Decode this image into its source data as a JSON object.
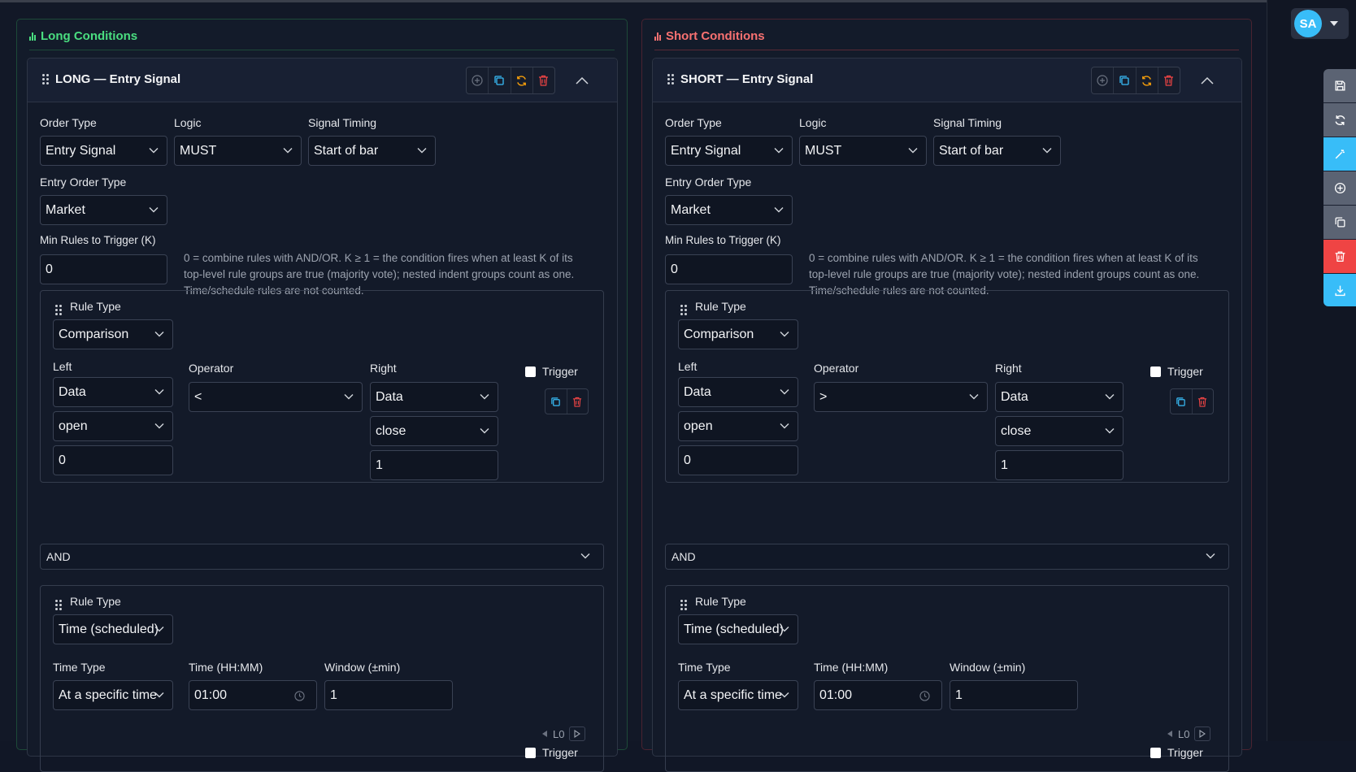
{
  "colors": {
    "long_accent": "#4ade80",
    "short_accent": "#f87171",
    "info": "#38bdf8",
    "warn": "#f59e0b",
    "danger": "#ef4444"
  },
  "user": {
    "initials": "SA"
  },
  "sidetools": [
    {
      "name": "save",
      "icon": "save-icon",
      "color": "#5b6373"
    },
    {
      "name": "refresh",
      "icon": "refresh-icon",
      "color": "#5b6373"
    },
    {
      "name": "magic",
      "icon": "magic-wand-icon",
      "color": "#38bdf8"
    },
    {
      "name": "add",
      "icon": "plus-circle-icon",
      "color": "#5b6373"
    },
    {
      "name": "copy",
      "icon": "copy-icon",
      "color": "#5b6373"
    },
    {
      "name": "delete",
      "icon": "trash-icon",
      "color": "#ef4444"
    },
    {
      "name": "download",
      "icon": "download-icon",
      "color": "#38bdf8"
    }
  ],
  "long": {
    "title": "Long Conditions",
    "card_title": "LONG — Entry Signal",
    "order_type_label": "Order Type",
    "order_type": "Entry Signal",
    "logic_label": "Logic",
    "logic": "MUST",
    "timing_label": "Signal Timing",
    "timing": "Start of bar",
    "entry_order_label": "Entry Order Type",
    "entry_order": "Market",
    "min_rules_label": "Min Rules to Trigger (K)",
    "min_rules": "0",
    "help": "0 = combine rules with AND/OR. K ≥ 1 = the condition fires when at least K of its top-level rule groups are true (majority vote); nested indent groups count as one. Time/schedule rules are not counted.",
    "rule1": {
      "type_label": "Rule Type",
      "type": "Comparison",
      "left_label": "Left",
      "left_source": "Data",
      "left_field": "open",
      "left_offset": "0",
      "op_label": "Operator",
      "op": "<",
      "right_label": "Right",
      "right_source": "Data",
      "right_field": "close",
      "right_offset": "1",
      "trigger_label": "Trigger"
    },
    "joiner": "AND",
    "rule2": {
      "type_label": "Rule Type",
      "type": "Time (scheduled)",
      "time_type_label": "Time Type",
      "time_type": "At a specific time",
      "time_label": "Time (HH:MM)",
      "time": "01:00",
      "window_label": "Window (±min)",
      "window": "1",
      "level": "L0",
      "trigger_label": "Trigger"
    }
  },
  "short": {
    "title": "Short Conditions",
    "card_title": "SHORT — Entry Signal",
    "order_type_label": "Order Type",
    "order_type": "Entry Signal",
    "logic_label": "Logic",
    "logic": "MUST",
    "timing_label": "Signal Timing",
    "timing": "Start of bar",
    "entry_order_label": "Entry Order Type",
    "entry_order": "Market",
    "min_rules_label": "Min Rules to Trigger (K)",
    "min_rules": "0",
    "help": "0 = combine rules with AND/OR. K ≥ 1 = the condition fires when at least K of its top-level rule groups are true (majority vote); nested indent groups count as one. Time/schedule rules are not counted.",
    "rule1": {
      "type_label": "Rule Type",
      "type": "Comparison",
      "left_label": "Left",
      "left_source": "Data",
      "left_field": "open",
      "left_offset": "0",
      "op_label": "Operator",
      "op": ">",
      "right_label": "Right",
      "right_source": "Data",
      "right_field": "close",
      "right_offset": "1",
      "trigger_label": "Trigger"
    },
    "joiner": "AND",
    "rule2": {
      "type_label": "Rule Type",
      "type": "Time (scheduled)",
      "time_type_label": "Time Type",
      "time_type": "At a specific time",
      "time_label": "Time (HH:MM)",
      "time": "01:00",
      "window_label": "Window (±min)",
      "window": "1",
      "level": "L0",
      "trigger_label": "Trigger"
    }
  }
}
